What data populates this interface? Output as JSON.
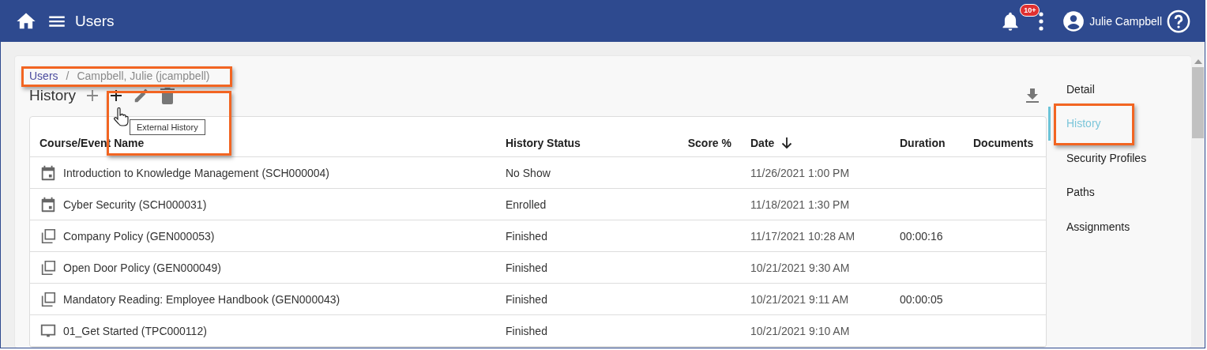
{
  "header": {
    "title": "Users",
    "notification_badge": "10+",
    "user_name": "Julie Campbell"
  },
  "breadcrumb": [
    {
      "label": "Users",
      "kind": "link"
    },
    {
      "label": "/",
      "kind": "separator"
    },
    {
      "label": "Campbell, Julie (jcampbell)",
      "kind": "current"
    }
  ],
  "history": {
    "title": "History",
    "tooltip": "External History"
  },
  "table": {
    "columns": [
      {
        "label": "Course/Event Name",
        "sorted": false
      },
      {
        "label": "History Status",
        "sorted": false
      },
      {
        "label": "Score %",
        "sorted": false
      },
      {
        "label": "Date",
        "sorted": true
      },
      {
        "label": "Duration",
        "sorted": false
      },
      {
        "label": "Documents",
        "sorted": false
      }
    ],
    "rows": [
      {
        "kind": "event",
        "name": "Introduction to Knowledge Management (SCH000004)",
        "status": "No Show",
        "date": "11/26/2021 1:00 PM"
      },
      {
        "kind": "event",
        "name": "Cyber Security (SCH000031)",
        "status": "Enrolled",
        "date": "11/18/2021 1:30 PM"
      },
      {
        "kind": "document",
        "name": "Company Policy (GEN000053)",
        "status": "Finished",
        "date": "11/17/2021 10:28 AM",
        "duration": "00:00:16"
      },
      {
        "kind": "document",
        "name": "Open Door Policy (GEN000049)",
        "status": "Finished",
        "date": "10/21/2021 9:30 AM"
      },
      {
        "kind": "document",
        "name": "Mandatory Reading: Employee Handbook (GEN000043)",
        "status": "Finished",
        "date": "10/21/2021 9:11 AM",
        "duration": "00:00:05"
      },
      {
        "kind": "course",
        "name": "01_Get Started (TPC000112)",
        "status": "Finished",
        "date": "10/21/2021 9:10 AM"
      }
    ]
  },
  "side_nav": [
    {
      "label": "Detail",
      "selected": false
    },
    {
      "label": "History",
      "selected": true
    },
    {
      "label": "Security Profiles",
      "selected": false
    },
    {
      "label": "Paths",
      "selected": false
    },
    {
      "label": "Assignments",
      "selected": false
    }
  ]
}
